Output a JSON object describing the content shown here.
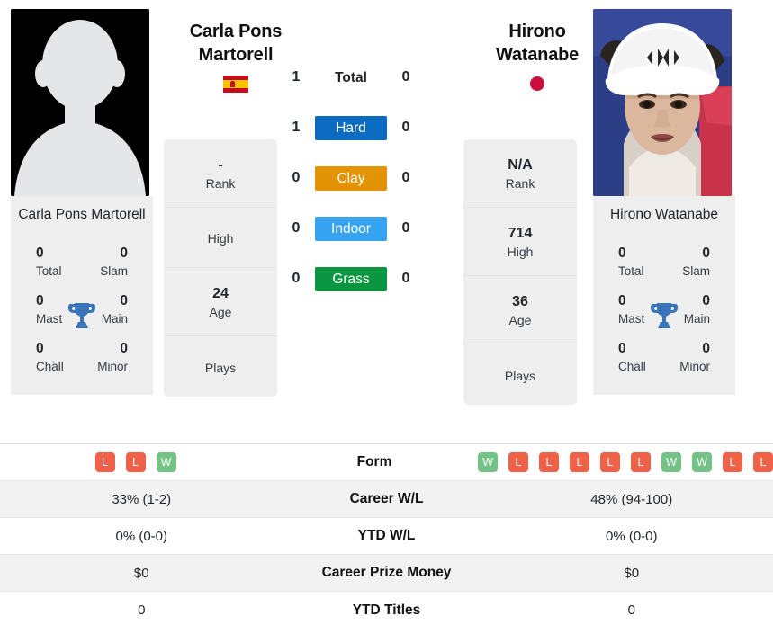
{
  "players": {
    "left": {
      "name": "Carla Pons Martorell",
      "caption": "Carla Pons Martorell",
      "flag_name": "spain-flag",
      "flag_alt": "Spain",
      "photo_type": "placeholder-silhouette",
      "info": [
        {
          "value": "-",
          "label": "Rank"
        },
        {
          "value": "",
          "label": "High"
        },
        {
          "value": "24",
          "label": "Age"
        },
        {
          "value": "",
          "label": "Plays"
        }
      ],
      "titles": [
        {
          "value": "0",
          "label": "Total"
        },
        {
          "value": "0",
          "label": "Slam"
        },
        {
          "value": "0",
          "label": "Mast"
        },
        {
          "value": "0",
          "label": "Main"
        },
        {
          "value": "0",
          "label": "Chall"
        },
        {
          "value": "0",
          "label": "Minor"
        }
      ],
      "form": [
        "L",
        "L",
        "W"
      ],
      "career_wl": "33% (1-2)",
      "ytd_wl": "0% (0-0)",
      "career_prize_money": "$0",
      "ytd_titles": "0"
    },
    "right": {
      "name": "Hirono Watanabe",
      "caption": "Hirono Watanabe",
      "flag_name": "japan-flag",
      "flag_alt": "Japan",
      "photo_type": "photo",
      "info": [
        {
          "value": "N/A",
          "label": "Rank"
        },
        {
          "value": "714",
          "label": "High"
        },
        {
          "value": "36",
          "label": "Age"
        },
        {
          "value": "",
          "label": "Plays"
        }
      ],
      "titles": [
        {
          "value": "0",
          "label": "Total"
        },
        {
          "value": "0",
          "label": "Slam"
        },
        {
          "value": "0",
          "label": "Mast"
        },
        {
          "value": "0",
          "label": "Main"
        },
        {
          "value": "0",
          "label": "Chall"
        },
        {
          "value": "0",
          "label": "Minor"
        }
      ],
      "form": [
        "W",
        "L",
        "L",
        "L",
        "L",
        "L",
        "W",
        "W",
        "L",
        "L"
      ],
      "career_wl": "48% (94-100)",
      "ytd_wl": "0% (0-0)",
      "career_prize_money": "$0",
      "ytd_titles": "0"
    }
  },
  "surfaces": [
    {
      "label": "Total",
      "left": "1",
      "right": "0",
      "color": "",
      "plain": true
    },
    {
      "label": "Hard",
      "left": "1",
      "right": "0",
      "color": "#0b6bc0",
      "plain": false
    },
    {
      "label": "Clay",
      "left": "0",
      "right": "0",
      "color": "#e29404",
      "plain": false
    },
    {
      "label": "Indoor",
      "left": "0",
      "right": "0",
      "color": "#35a3f0",
      "plain": false
    },
    {
      "label": "Grass",
      "left": "0",
      "right": "0",
      "color": "#0a9640",
      "plain": false
    }
  ],
  "stats": [
    {
      "label": "Form",
      "type": "form"
    },
    {
      "label": "Career W/L",
      "type": "text",
      "key": "career_wl"
    },
    {
      "label": "YTD W/L",
      "type": "text",
      "key": "ytd_wl"
    },
    {
      "label": "Career Prize Money",
      "type": "text",
      "key": "career_prize_money"
    },
    {
      "label": "YTD Titles",
      "type": "text",
      "key": "ytd_titles"
    }
  ],
  "colors": {
    "hard": "#0b6bc0",
    "clay": "#e29404",
    "indoor": "#35a3f0",
    "grass": "#0a9640",
    "win_badge": "#74c285",
    "loss_badge": "#f0614a",
    "card_bg": "#eeeeee",
    "row_stripe": "#f2f2f2",
    "trophy": "#3a74b8"
  },
  "icons": {
    "trophy": "trophy-icon"
  }
}
